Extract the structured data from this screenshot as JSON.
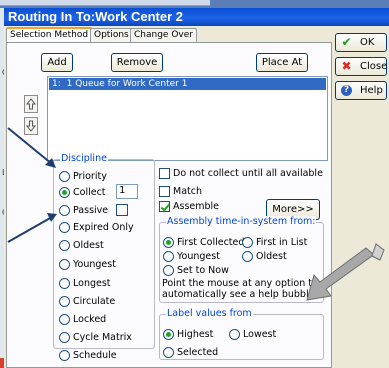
{
  "window": {
    "title": "Routing In To:Work Center 2"
  },
  "background": {
    "letters": [
      "C",
      "L",
      "C"
    ]
  },
  "tabs": [
    {
      "label": "Selection Method"
    },
    {
      "label": "Options"
    },
    {
      "label": "Change Over"
    }
  ],
  "toolbar": {
    "add_label": "Add",
    "remove_label": "Remove",
    "place_at_label": "Place At"
  },
  "list": {
    "items": [
      {
        "index": "1:",
        "text": "1   Queue for Work Center 1",
        "selected": true
      }
    ]
  },
  "side_icons": [
    "up-arrow-icon",
    "down-arrow-icon"
  ],
  "discipline": {
    "title": "Discipline",
    "options": [
      {
        "label": "Priority",
        "selected": false
      },
      {
        "label": "Collect",
        "selected": true
      },
      {
        "label": "Passive",
        "selected": false
      },
      {
        "label": "Expired Only",
        "selected": false
      },
      {
        "label": "Oldest",
        "selected": false
      },
      {
        "label": "Youngest",
        "selected": false
      },
      {
        "label": "Longest",
        "selected": false
      },
      {
        "label": "Circulate",
        "selected": false
      },
      {
        "label": "Locked",
        "selected": false
      },
      {
        "label": "Cycle Matrix",
        "selected": false
      },
      {
        "label": "Schedule",
        "selected": false
      }
    ],
    "collect_value": "1",
    "passive_checked": false
  },
  "checkboxes": {
    "do_not_collect": {
      "label": "Do not collect until all available",
      "checked": false
    },
    "match": {
      "label": "Match",
      "checked": false
    },
    "assemble": {
      "label": "Assemble",
      "checked": true
    }
  },
  "more_button": {
    "label": "More>>"
  },
  "assembly_time": {
    "title": "Assembly time-in-system from:",
    "options": [
      {
        "label": "First Collected",
        "selected": true
      },
      {
        "label": "First in List",
        "selected": false
      },
      {
        "label": "Youngest",
        "selected": false
      },
      {
        "label": "Oldest",
        "selected": false
      },
      {
        "label": "Set to Now",
        "selected": false
      }
    ]
  },
  "help_note": "Point the mouse at any option to automatically see a help bubble.",
  "label_values": {
    "title": "Label values from",
    "options": [
      {
        "label": "Highest",
        "selected": true
      },
      {
        "label": "Lowest",
        "selected": false
      },
      {
        "label": "Selected",
        "selected": false
      }
    ]
  },
  "right_buttons": [
    {
      "label": "OK",
      "icon": "check-icon",
      "color": "#1e9a1e"
    },
    {
      "label": "Close",
      "icon": "close-icon",
      "color": "#d62d20"
    },
    {
      "label": "Help",
      "icon": "help-icon",
      "color": "#2f5fbf"
    }
  ],
  "colors": {
    "title_bar": "#0a4fd3",
    "group_label": "#0046d5",
    "annotation_arrow": "#8c8c8c",
    "selection": "#316ac5"
  }
}
